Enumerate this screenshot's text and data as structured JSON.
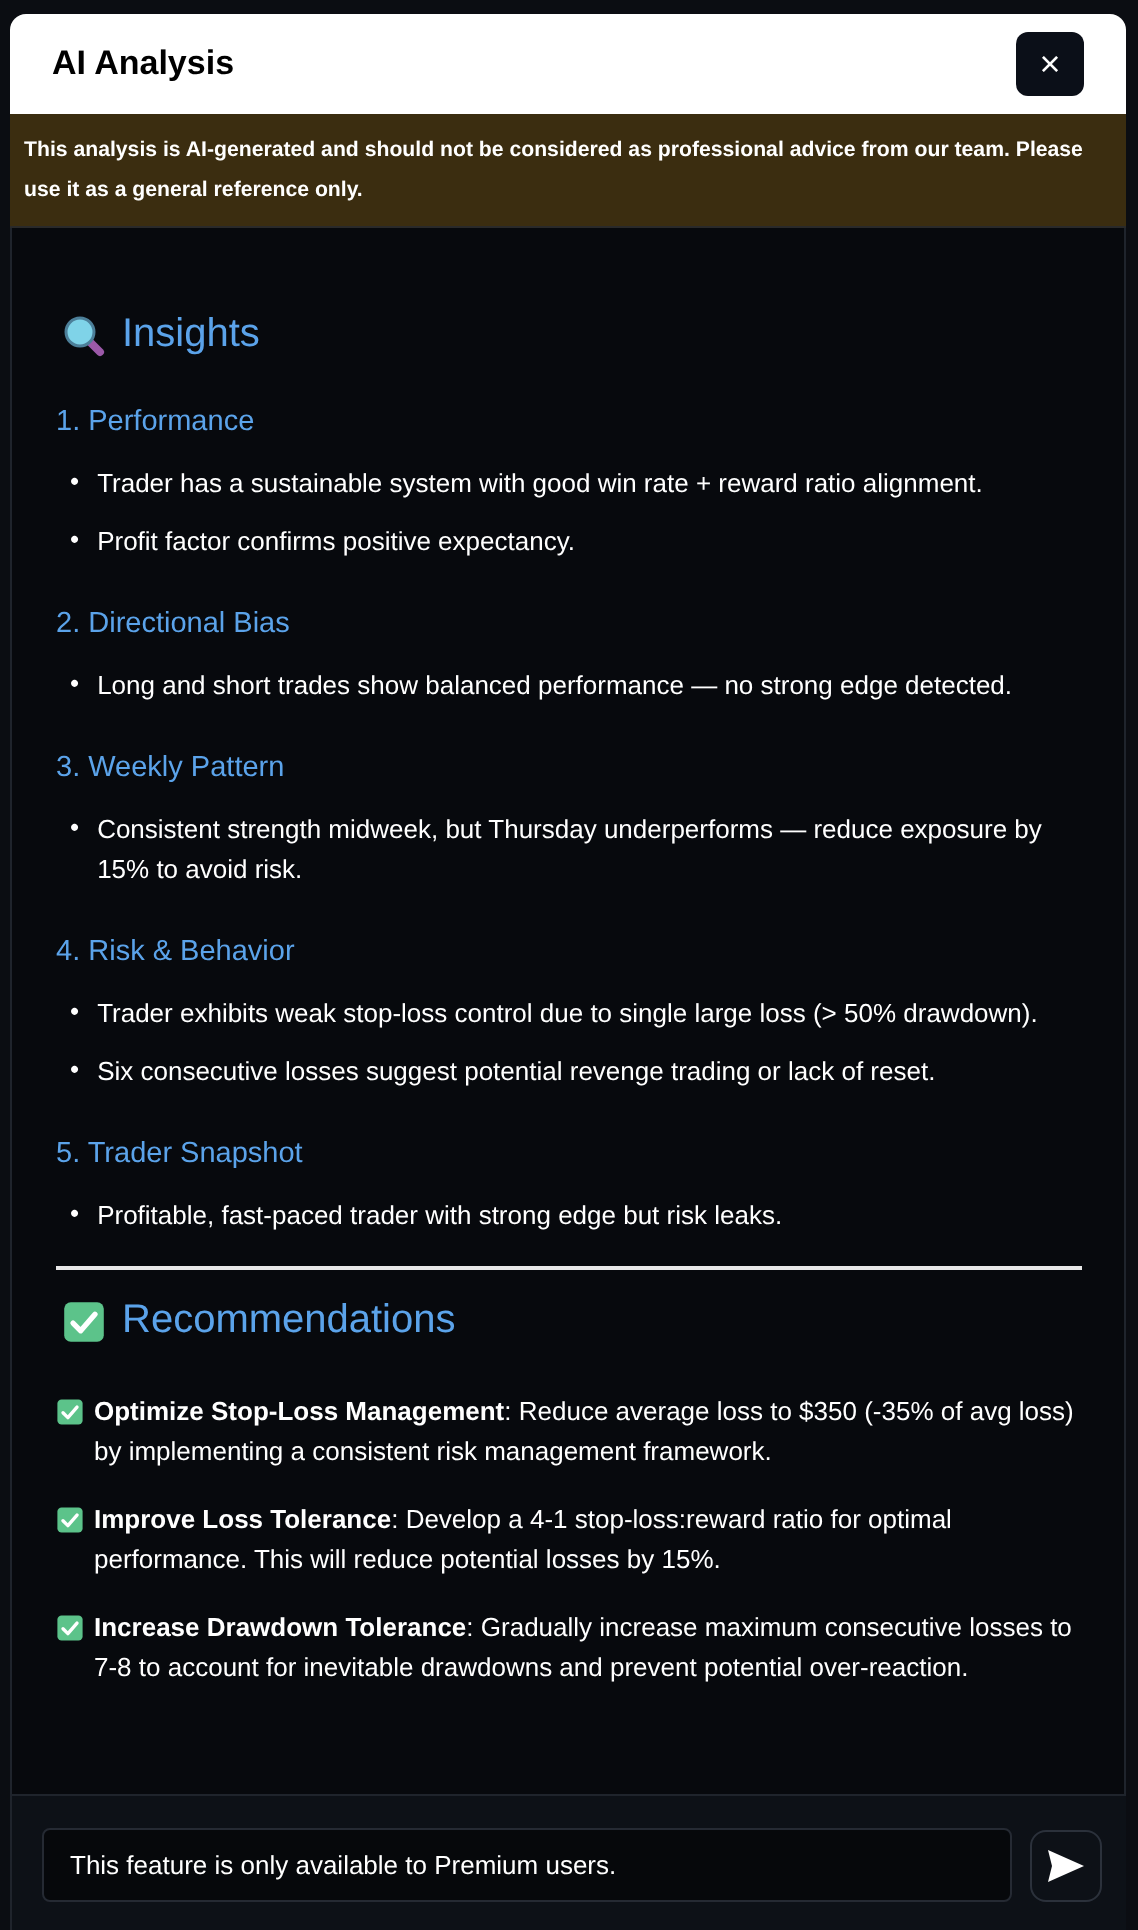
{
  "dialog": {
    "title": "AI Analysis",
    "close_label": "×"
  },
  "notice": "This analysis is AI-generated and should not be considered as professional advice from our team. Please use it as a general reference only.",
  "insights": {
    "heading": "Insights",
    "sections": [
      {
        "title": "1. Performance",
        "bullets": [
          {
            "marker": "•",
            "text": "Trader has a sustainable system with good win rate + reward ratio alignment."
          },
          {
            "marker": "•",
            "text": "Profit factor confirms positive expectancy."
          }
        ]
      },
      {
        "title": "2. Directional Bias",
        "bullets": [
          {
            "marker": "•",
            "text": "Long and short trades show balanced performance — no strong edge detected."
          }
        ]
      },
      {
        "title": "3. Weekly Pattern",
        "bullets": [
          {
            "marker": "•",
            "text": "Consistent strength midweek, but Thursday underperforms — reduce exposure by 15% to avoid risk."
          }
        ]
      },
      {
        "title": "4. Risk & Behavior",
        "bullets": [
          {
            "marker": "•",
            "text": "Trader exhibits weak stop-loss control due to single large loss (> 50% drawdown)."
          },
          {
            "marker": "•",
            "text": "Six consecutive losses suggest potential revenge trading or lack of reset."
          }
        ]
      },
      {
        "title": "5. Trader Snapshot",
        "bullets": [
          {
            "marker": "•",
            "text": "Profitable, fast-paced trader with strong edge but risk leaks."
          }
        ]
      }
    ]
  },
  "recommendations": {
    "heading": "Recommendations",
    "items": [
      "**Optimize Stop-Loss Management**: Reduce average loss to $350 (-35% of avg loss) by implementing a consistent risk management framework.",
      "**Improve Loss Tolerance**: Develop a 4-1 stop-loss:reward ratio for optimal performance. This will reduce potential losses by 15%.",
      "**Increase Drawdown Tolerance**: Gradually increase maximum consecutive losses to 7-8 to account for inevitable drawdowns and prevent potential over-reaction."
    ]
  },
  "chat_input": {
    "value": "This feature is only available to Premium users."
  }
}
